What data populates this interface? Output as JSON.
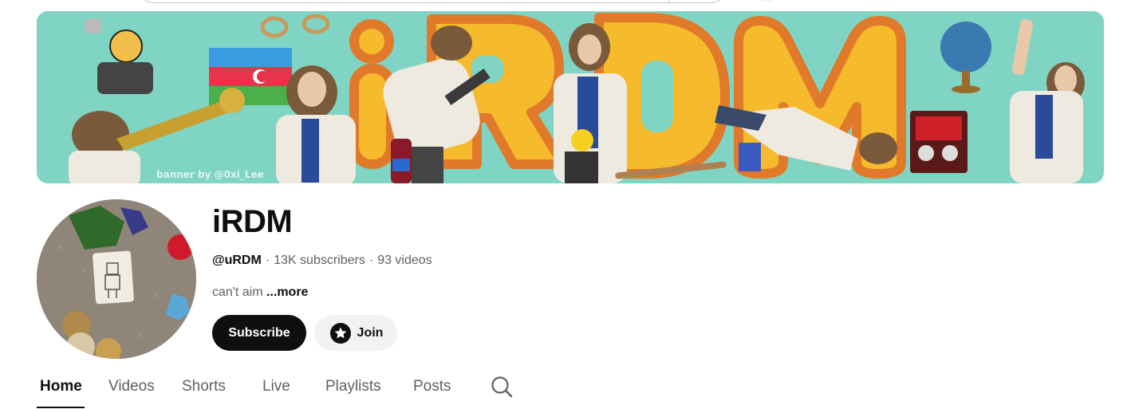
{
  "banner": {
    "credit": "banner by @0xi_Lee",
    "title_letters": "iRDM",
    "colors": {
      "background": "#7fd4c4",
      "letter_fill": "#f5bb2c",
      "letter_outline": "#e07a2a"
    }
  },
  "channel": {
    "name": "iRDM",
    "handle": "@uRDM",
    "subscribers": "13K subscribers",
    "videos": "93 videos",
    "separator": "·",
    "description": "can't aim",
    "more_label": "...more"
  },
  "buttons": {
    "subscribe_label": "Subscribe",
    "join_label": "Join"
  },
  "tabs": [
    {
      "label": "Home",
      "active": true
    },
    {
      "label": "Videos",
      "active": false
    },
    {
      "label": "Shorts",
      "active": false
    },
    {
      "label": "Live",
      "active": false
    },
    {
      "label": "Playlists",
      "active": false
    },
    {
      "label": "Posts",
      "active": false
    }
  ],
  "icons": {
    "tab_search": "search-icon",
    "join": "star-badge-icon"
  }
}
